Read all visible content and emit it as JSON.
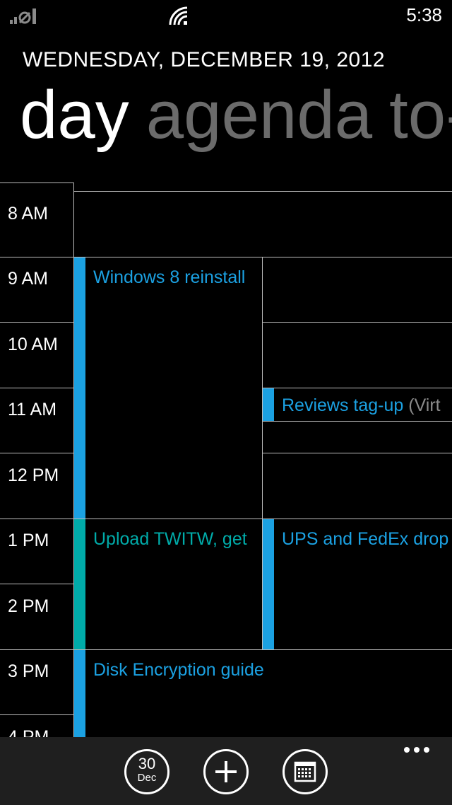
{
  "status_bar": {
    "time": "5:38",
    "signal_icon": "signal-no-sim-icon",
    "wifi_icon": "wifi-icon"
  },
  "header": {
    "date": "WEDNESDAY, DECEMBER 19, 2012",
    "pivots": [
      "day",
      "agenda",
      "to-"
    ]
  },
  "hours": [
    "8 AM",
    "9 AM",
    "10 AM",
    "11 AM",
    "12 PM",
    "1 PM",
    "2 PM",
    "3 PM",
    "4 PM"
  ],
  "events": [
    {
      "title": "Windows 8 reinstall",
      "location": "",
      "color": "#1ba1e2"
    },
    {
      "title": "Reviews tag-up",
      "location": " (Virt",
      "color": "#1ba1e2"
    },
    {
      "title": "Upload TWITW, get",
      "location": "",
      "color": "#00aba9"
    },
    {
      "title": "UPS and FedEx drop",
      "location": "",
      "color": "#1ba1e2"
    },
    {
      "title": "Disk Encryption guide",
      "location": "",
      "color": "#1ba1e2"
    }
  ],
  "app_bar": {
    "today_day": "30",
    "today_month": "Dec",
    "add_icon": "add-icon",
    "calendar_icon": "calendar-month-icon",
    "more_icon": "ellipsis-icon"
  },
  "colors": {
    "accent_blue": "#1ba1e2",
    "accent_teal": "#00aba9",
    "background": "#000000",
    "app_bar": "#1f1f1f"
  }
}
